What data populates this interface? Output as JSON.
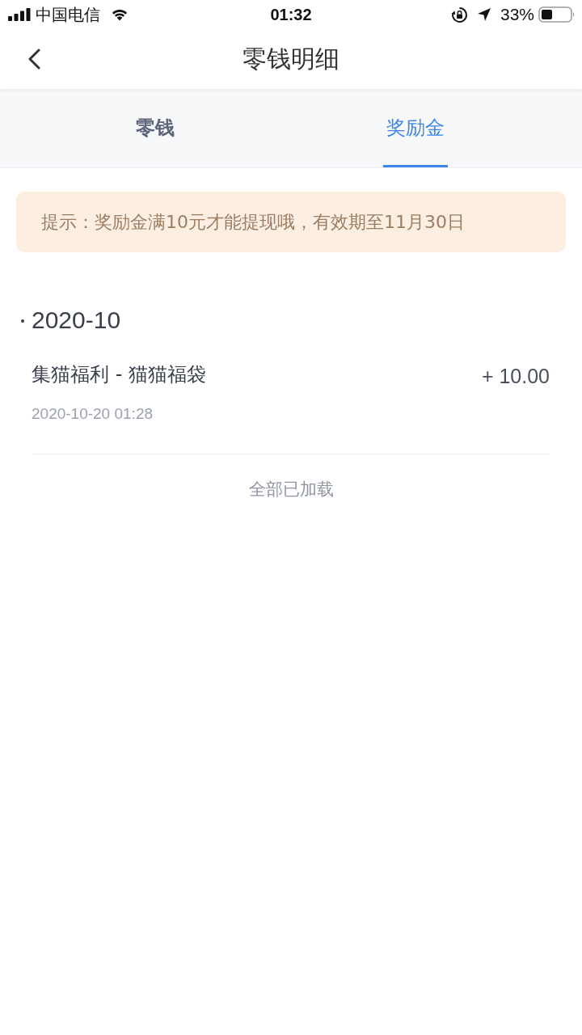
{
  "status_bar": {
    "carrier": "中国电信",
    "time": "01:32",
    "battery_percent": "33%"
  },
  "nav": {
    "title": "零钱明细"
  },
  "tabs": [
    {
      "label": "零钱",
      "selected": false
    },
    {
      "label": "奖励金",
      "selected": true
    }
  ],
  "notice": {
    "text": "提示：奖励金满10元才能提现哦，有效期至11月30日"
  },
  "groups": [
    {
      "month": "2020-10",
      "records": [
        {
          "title": "集猫福利 - 猫猫福袋",
          "amount": "+ 10.00",
          "time": "2020-10-20 01:28"
        }
      ]
    }
  ],
  "footer": {
    "text": "全部已加载"
  }
}
